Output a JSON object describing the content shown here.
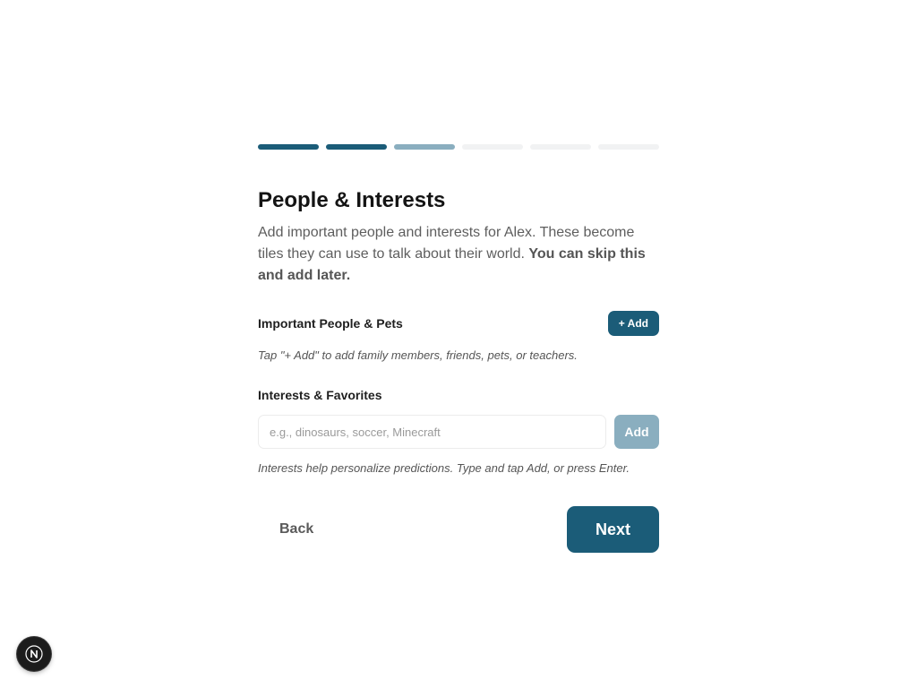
{
  "progress": {
    "steps": [
      "done",
      "done",
      "current",
      "todo",
      "todo",
      "todo"
    ],
    "colors": {
      "done": "#1b5c78",
      "current": "#8aaebf",
      "todo": "#f1f2f3"
    }
  },
  "header": {
    "title": "People & Interests",
    "intro": "Add important people and interests for Alex. These become tiles they can use to talk about their world. ",
    "intro_bold": "You can skip this and add later."
  },
  "people": {
    "label": "Important People & Pets",
    "add_label": "+ Add",
    "hint": "Tap \"+ Add\" to add family members, friends, pets, or teachers."
  },
  "interests": {
    "label": "Interests & Favorites",
    "input_value": "",
    "placeholder": "e.g., dinosaurs, soccer, Minecraft",
    "add_label": "Add",
    "hint": "Interests help personalize predictions. Type and tap Add, or press Enter."
  },
  "nav": {
    "back_label": "Back",
    "next_label": "Next"
  },
  "dev_badge": {
    "icon": "next-logo-icon"
  },
  "colors": {
    "primary": "#1b5c78",
    "primary_disabled": "#8aaebf"
  }
}
